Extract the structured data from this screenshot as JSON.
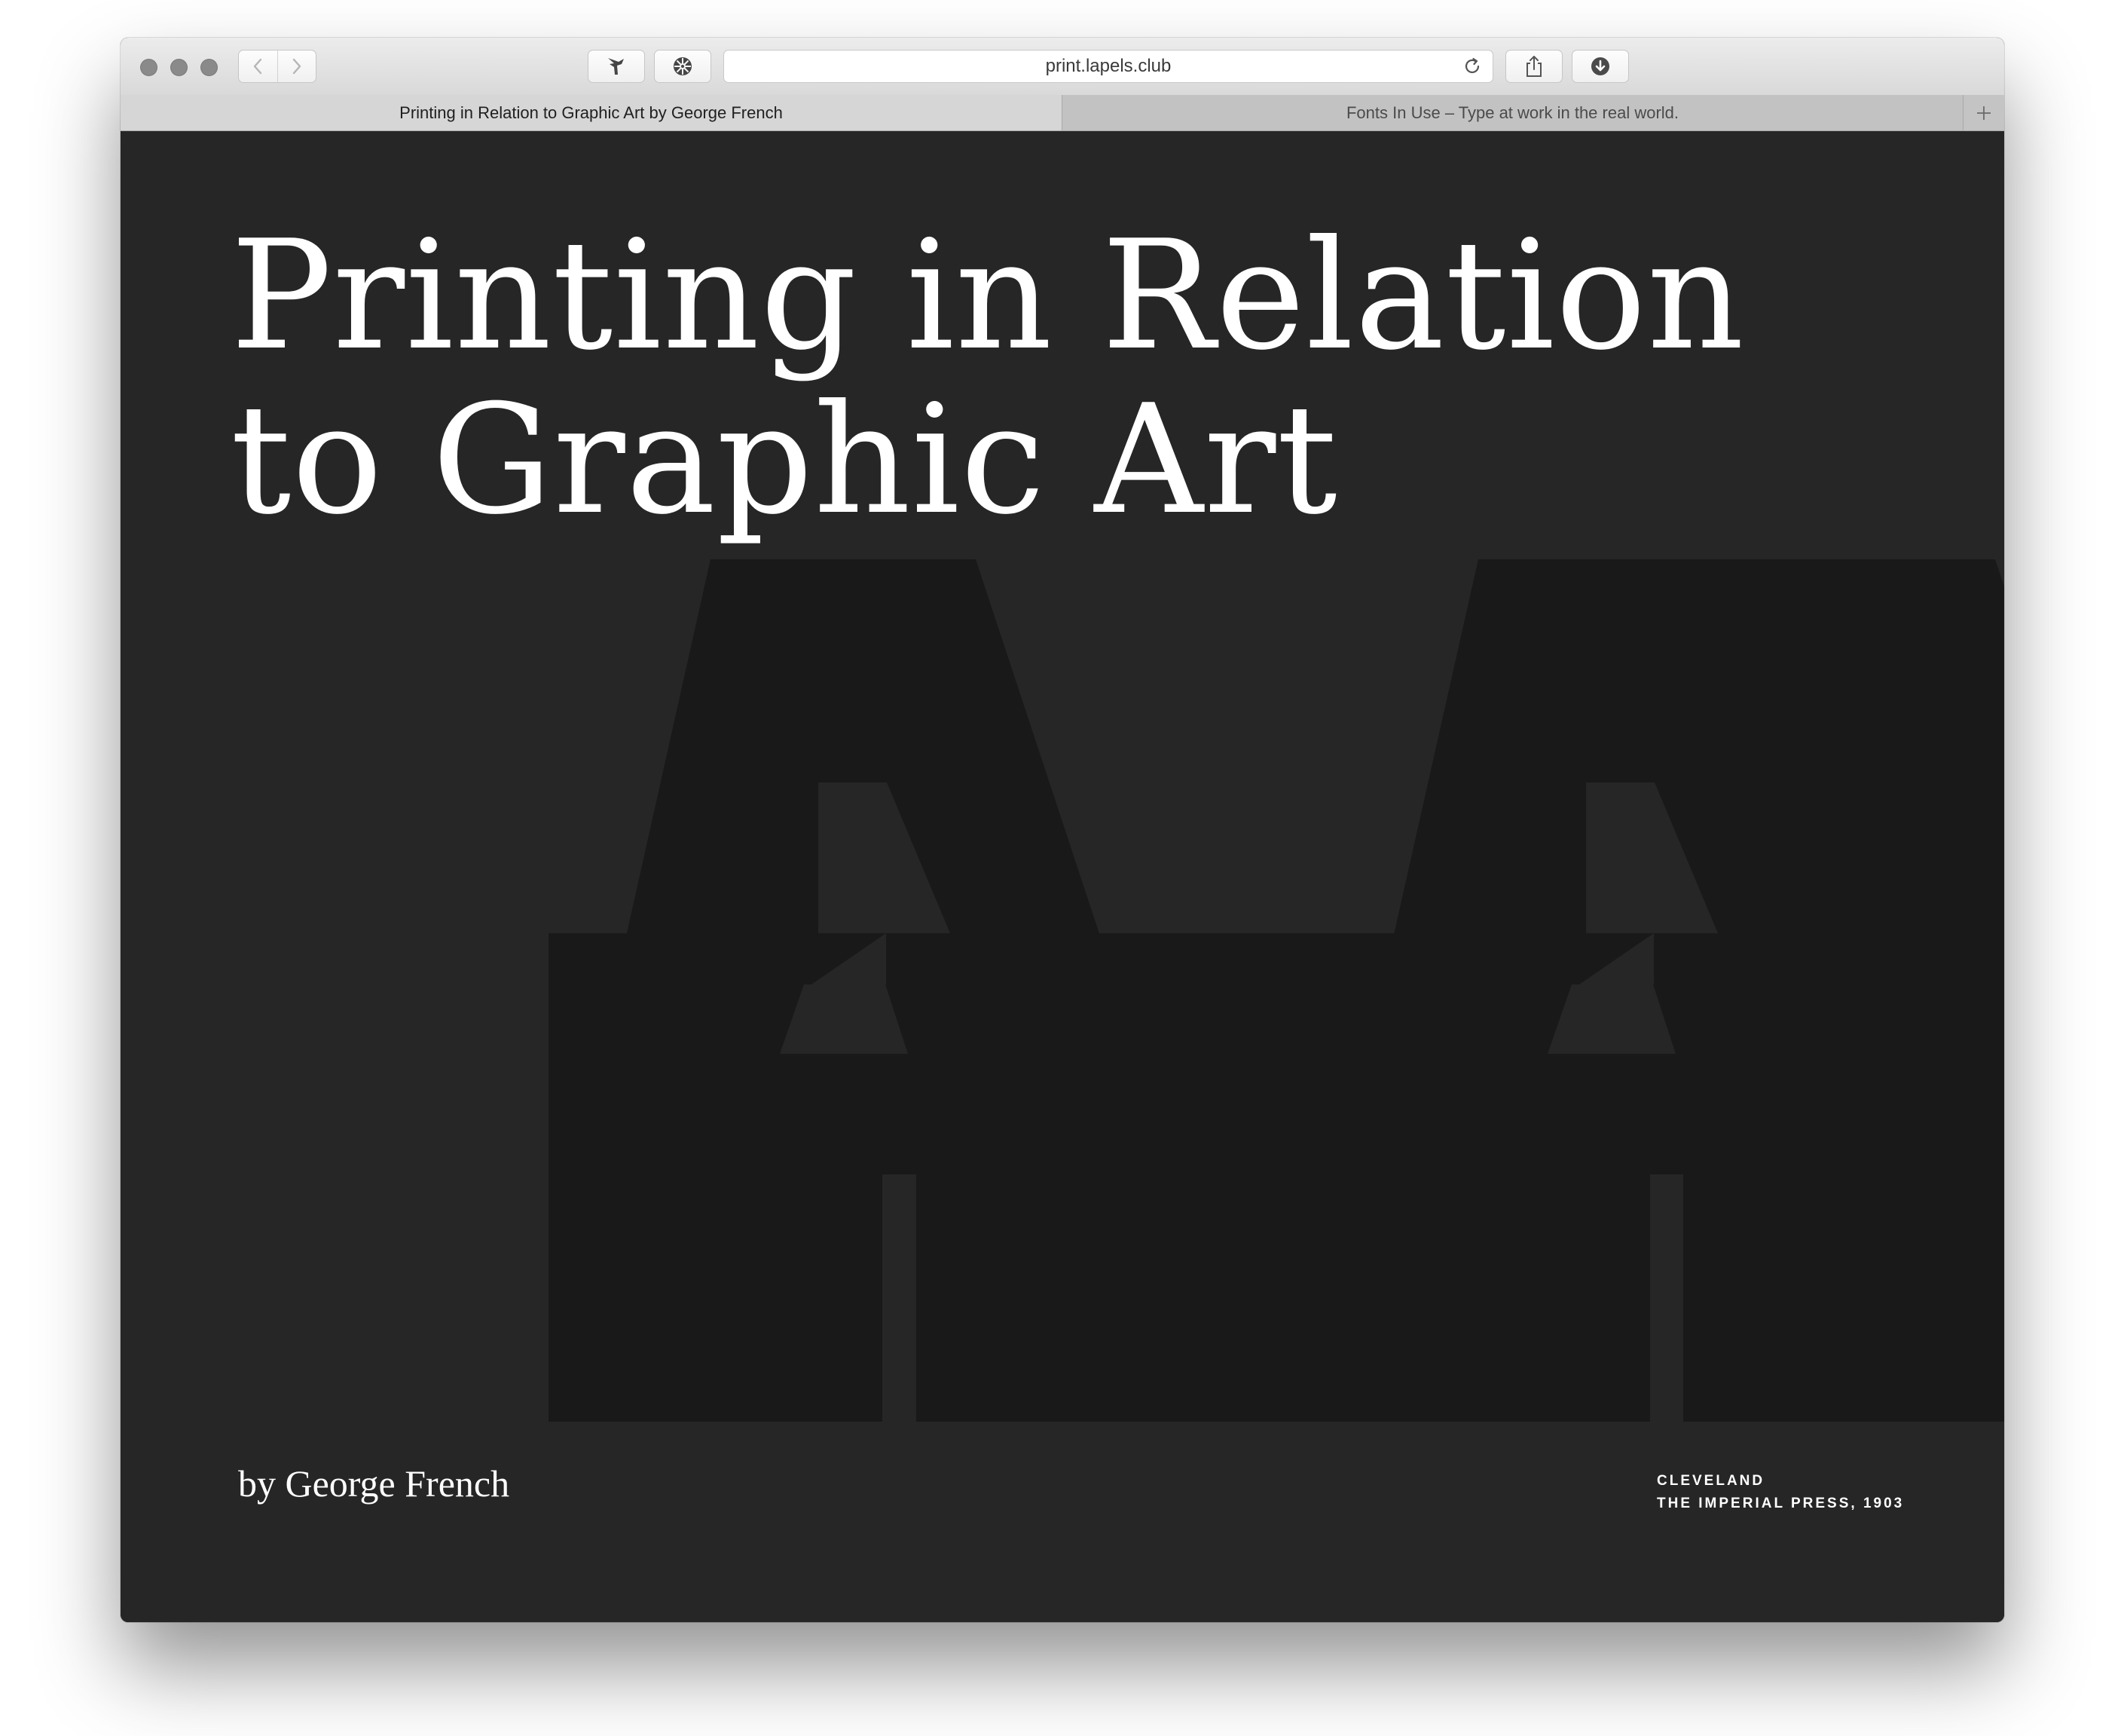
{
  "browser": {
    "url": "print.lapels.club",
    "tabs": [
      {
        "label": "Printing in Relation to Graphic Art by George French",
        "active": true
      },
      {
        "label": "Fonts In Use – Type at work in the real world.",
        "active": false
      }
    ],
    "icons": [
      "back-arrow-icon",
      "forward-arrow-icon",
      "bird-extension-icon",
      "ship-wheel-extension-icon",
      "reload-icon",
      "share-icon",
      "download-icon",
      "new-tab-plus-icon"
    ]
  },
  "page": {
    "title_line1": "Printing in Relation",
    "title_line2": "to Graphic Art",
    "author": "by George French",
    "imprint_line1": "CLEVELAND",
    "imprint_line2": "THE IMPERIAL PRESS, 1903"
  },
  "colors": {
    "page_background": "#262626",
    "background_art": "#191919",
    "text": "#ffffff"
  }
}
